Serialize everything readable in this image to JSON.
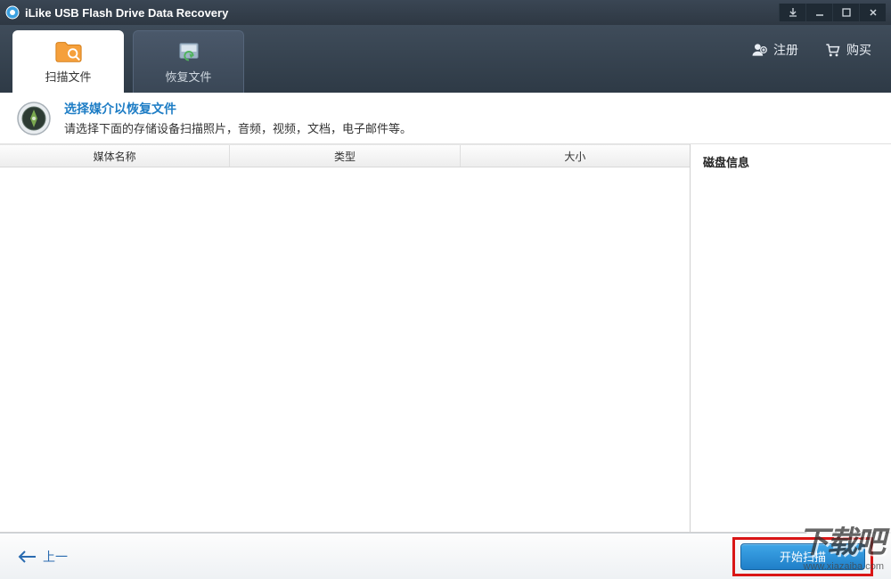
{
  "titlebar": {
    "title": "iLike USB Flash Drive Data Recovery"
  },
  "header": {
    "tabs": [
      {
        "label": "扫描文件",
        "active": true
      },
      {
        "label": "恢复文件",
        "active": false
      }
    ],
    "actions": {
      "register": "注册",
      "buy": "购买"
    }
  },
  "banner": {
    "title": "选择媒介以恢复文件",
    "desc": "请选择下面的存储设备扫描照片，音频，视频，文档，电子邮件等。"
  },
  "table": {
    "columns": [
      "媒体名称",
      "类型",
      "大小"
    ],
    "rows": []
  },
  "side": {
    "title": "磁盘信息"
  },
  "footer": {
    "back": "上一",
    "scan": "开始扫描"
  },
  "watermark": {
    "text": "下载吧",
    "url": "www.xiazaiba.com"
  }
}
